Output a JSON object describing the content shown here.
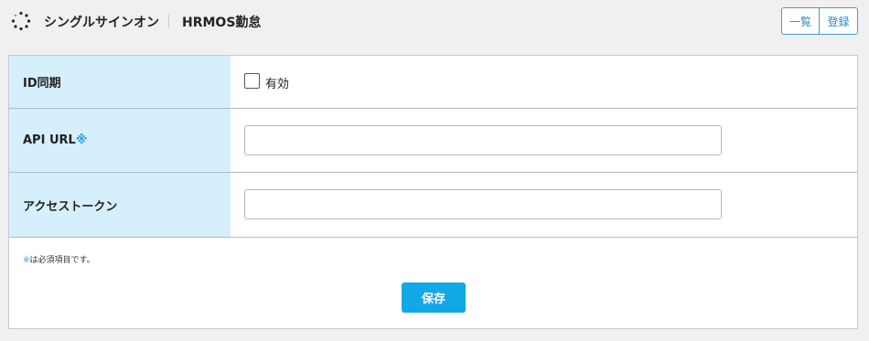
{
  "header": {
    "app_name": "シングルサインオン",
    "current_page": "HRMOS勤怠",
    "list_button": "一覧",
    "register_button": "登録"
  },
  "form": {
    "rows": [
      {
        "label": "ID同期",
        "required": false,
        "checkbox_label": "有効",
        "checked": false
      },
      {
        "label": "API URL",
        "required_mark": "※",
        "value": ""
      },
      {
        "label": "アクセストークン",
        "value": ""
      }
    ],
    "note_mark": "※",
    "note_text": "は必須項目です。",
    "save_button": "保存"
  },
  "colors": {
    "label_bg": "#d6effc",
    "accent": "#12a7e6",
    "required": "#1aa3e0"
  }
}
